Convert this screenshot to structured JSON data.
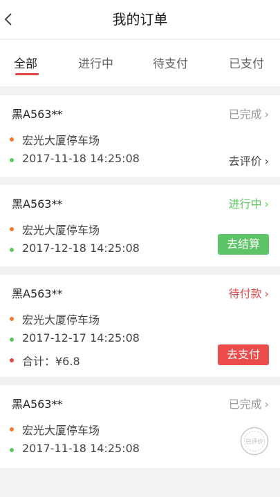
{
  "header": {
    "title": "我的订单"
  },
  "tabs": [
    {
      "label": "全部"
    },
    {
      "label": "进行中"
    },
    {
      "label": "待支付"
    },
    {
      "label": "已支付"
    }
  ],
  "orders": [
    {
      "plate": "黑A563**",
      "status": "已完成",
      "location": "宏光大厦停车场",
      "time": "2017-11-18   14:25:08",
      "action": "去评价"
    },
    {
      "plate": "黑A563**",
      "status": "进行中",
      "location": "宏光大厦停车场",
      "time": "2017-12-18   14:25:08",
      "action": "去结算"
    },
    {
      "plate": "黑A563**",
      "status": "待付款",
      "location": "宏光大厦停车场",
      "time": "2017-12-17   14:25:08",
      "total": "合计：¥6.8",
      "action": "去支付"
    },
    {
      "plate": "黑A563**",
      "status": "已完成",
      "location": "宏光大厦停车场",
      "time": "2017-11-18   14:25:08",
      "stamp": "已评价"
    }
  ],
  "colors": {
    "accent": "#e64545",
    "green": "#5cc85c",
    "orange": "#f07a2a",
    "red": "#ec4b4b",
    "gray": "#999999"
  }
}
